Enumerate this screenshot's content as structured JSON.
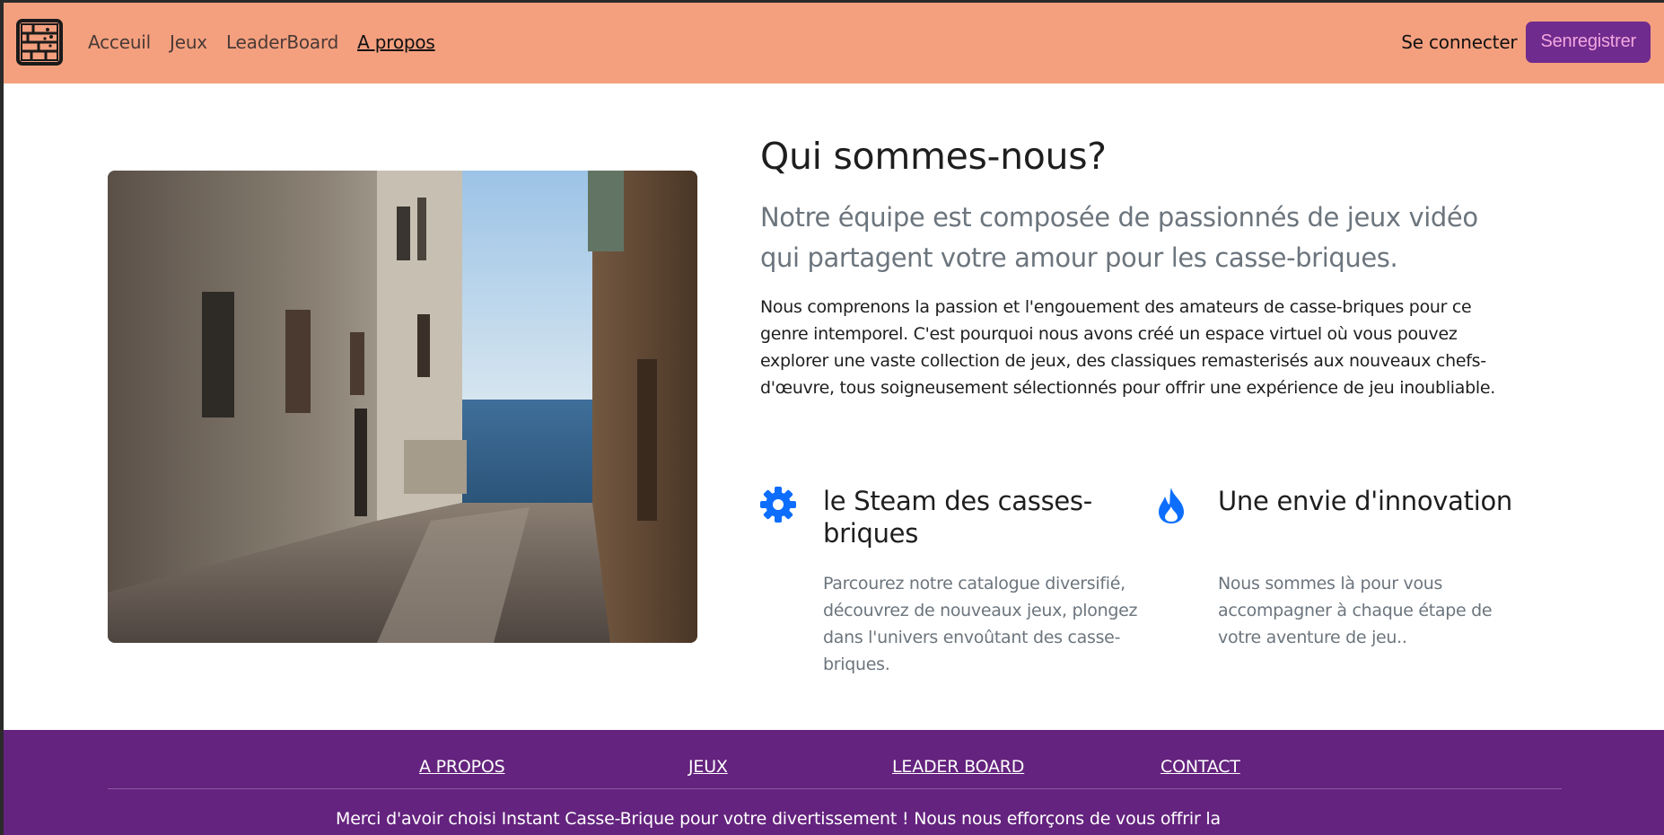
{
  "colors": {
    "navbar_bg": "#f4a07f",
    "register_bg": "#6f2b8d",
    "register_text": "#f3a7e0",
    "footer_bg": "#64237e",
    "icon_blue": "#0d6efd"
  },
  "navbar": {
    "logo_icon": "brick-wall-logo-icon",
    "links": [
      {
        "label": "Acceuil"
      },
      {
        "label": "Jeux"
      },
      {
        "label": "LeaderBoard"
      },
      {
        "label": "A propos"
      }
    ],
    "active_link": "A propos",
    "login_label": "Se connecter",
    "register_label": "Senregistrer"
  },
  "main": {
    "title": "Qui sommes-nous?",
    "lead": "Notre équipe est composée de passionnés de jeux vidéo qui partagent votre amour pour les casse-briques.",
    "body": "Nous comprenons la passion et l'engouement des amateurs de casse-briques pour ce genre intemporel. C'est pourquoi nous avons créé un espace virtuel où vous pouvez explorer une vaste collection de jeux, des classiques remasterisés aux nouveaux chefs-d'œuvre, tous soigneusement sélectionnés pour offrir une expérience de jeu inoubliable.",
    "features": [
      {
        "icon": "gear-icon",
        "title": "le Steam des casses-briques",
        "description": "Parcourez notre catalogue diversifié, découvrez de nouveaux jeux, plongez dans l'univers envoûtant des casse-briques."
      },
      {
        "icon": "fire-icon",
        "title": "Une envie d'innovation",
        "description": "Nous sommes là pour vous accompagner à chaque étape de votre aventure de jeu.."
      }
    ]
  },
  "footer": {
    "links": [
      {
        "label": "A PROPOS"
      },
      {
        "label": "JEUX"
      },
      {
        "label": "LEADER BOARD"
      },
      {
        "label": "CONTACT"
      }
    ],
    "text": "Merci d'avoir choisi Instant Casse-Brique pour votre divertissement ! Nous nous efforçons de vous offrir la"
  }
}
